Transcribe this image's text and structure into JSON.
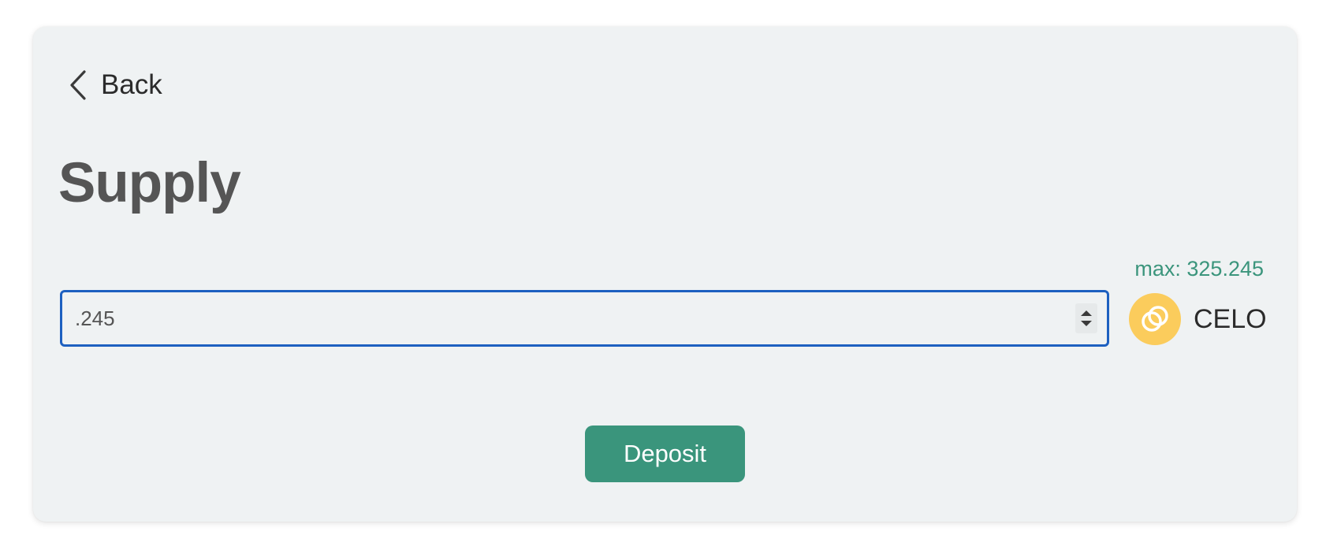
{
  "back": {
    "label": "Back",
    "icon": "chevron-left-icon"
  },
  "page": {
    "title": "Supply"
  },
  "amount": {
    "value": ".245",
    "max_label": "max: 325.245",
    "spinner_icon": "stepper-arrows-icon"
  },
  "token": {
    "symbol": "CELO",
    "icon": "celo-logo-icon",
    "logo_color": "#fbcc5c"
  },
  "actions": {
    "deposit_label": "Deposit"
  },
  "colors": {
    "accent": "#3a957c",
    "focus_border": "#1d60c0",
    "card_background": "#eff2f3"
  }
}
